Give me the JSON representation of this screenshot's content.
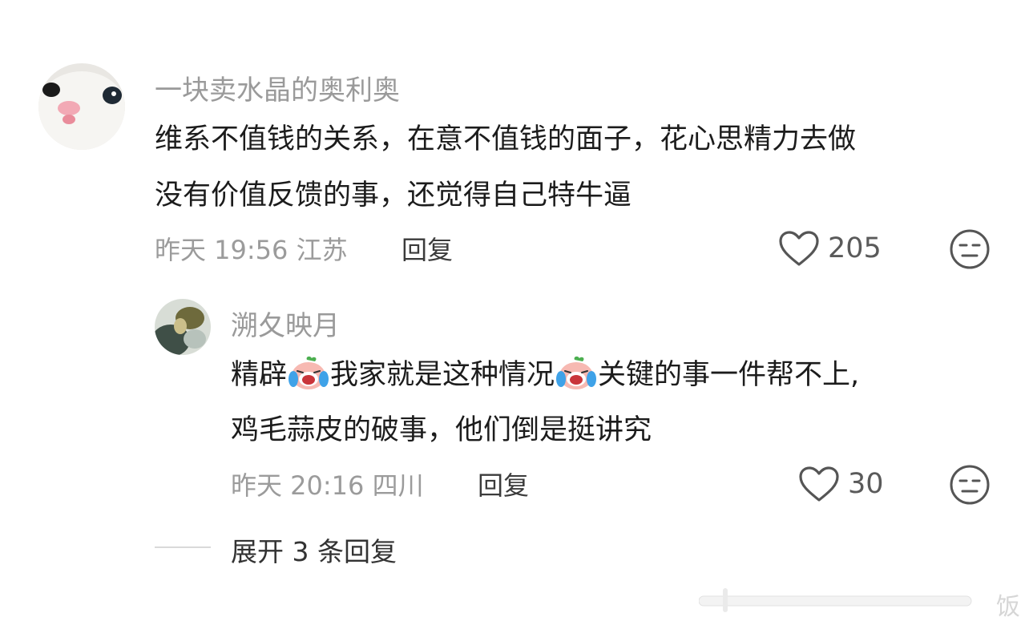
{
  "comment": {
    "username": "一块卖水晶的奥利奥",
    "text_line1": "维系不值钱的关系，在意不值钱的面子，花心思精力去做",
    "text_line2": "没有价值反馈的事，还觉得自己特牛逼",
    "time": "昨天 19:56",
    "location": "江苏",
    "reply_label": "回复",
    "likes": "205"
  },
  "reply": {
    "username": "溯夂映月",
    "seg1": "精辟",
    "seg2": "我家就是这种情况",
    "seg3": "关键的事一件帮不上,",
    "text_line2": "鸡毛蒜皮的破事，他们倒是挺讲究",
    "time": "昨天 20:16",
    "location": "四川",
    "reply_label": "回复",
    "likes": "30",
    "emoji_name": "crying-face-emoji"
  },
  "expand": {
    "label": "展开 3 条回复"
  },
  "watermark": {
    "text": "饭"
  },
  "icons": {
    "like": "heart-outline-icon",
    "dislike": "unamused-face-icon"
  }
}
